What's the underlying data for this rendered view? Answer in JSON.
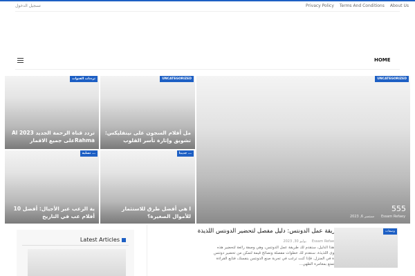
{
  "topbar": {
    "links": [
      "Privacy Policy",
      "Terms And Conditions",
      "About Us"
    ],
    "login": "تسجيل الدخول"
  },
  "nav": {
    "home": "HOME"
  },
  "cards": [
    {
      "badge": "UNCATEGORIZED",
      "title": "مل أفلام السجون على نيتفليكس: تشويق وإثارة تأسر القلوب"
    },
    {
      "badge": "ترددات القنوات",
      "title": "تردد قناة الرحمة الجديد 2023 Al Rahmaعلى جميع الاقمار"
    },
    {
      "badge": "جديدا ...",
      "title": "ا هي أفضل طرق للاستثمار للأموال الصغيرة؟"
    },
    {
      "badge": "تسلية ...",
      "title": "ية الرعب عبر الأجيال: أفضل 10 أفلام عب في التاريخ"
    }
  ],
  "featured": {
    "badge": "UNCATEGORIZED",
    "num": "555",
    "author": "Essam Refaey",
    "date": "سبتمبر 6, 2023"
  },
  "sidebar": {
    "heading": "Latest Articles"
  },
  "article": {
    "badge": "وصفات",
    "title": "طريقة عمل الدونتس: دليل مفصل لتحضير الدونتس اللذيذة",
    "author": "Essam Refaey",
    "date": "يوليو 30, 2023",
    "excerpt": "في هذا الدليل، سنقدم لك طريقة عمل الدونتس، وهي وصفة رائعة لتحضير هذه الحلوى اللذيذة. سنقدم لك خطوات مفصلة ونصائح قيمة لتمكن من تحضير دونتس لذيذة في المنزل. فإذا كنت ترغب في تجربة صنع الدونتس بنفسك، فتابع القراءة واستمتع بمغامرة الطهي..."
  },
  "colors": {
    "accent": "#1d5fc4"
  }
}
